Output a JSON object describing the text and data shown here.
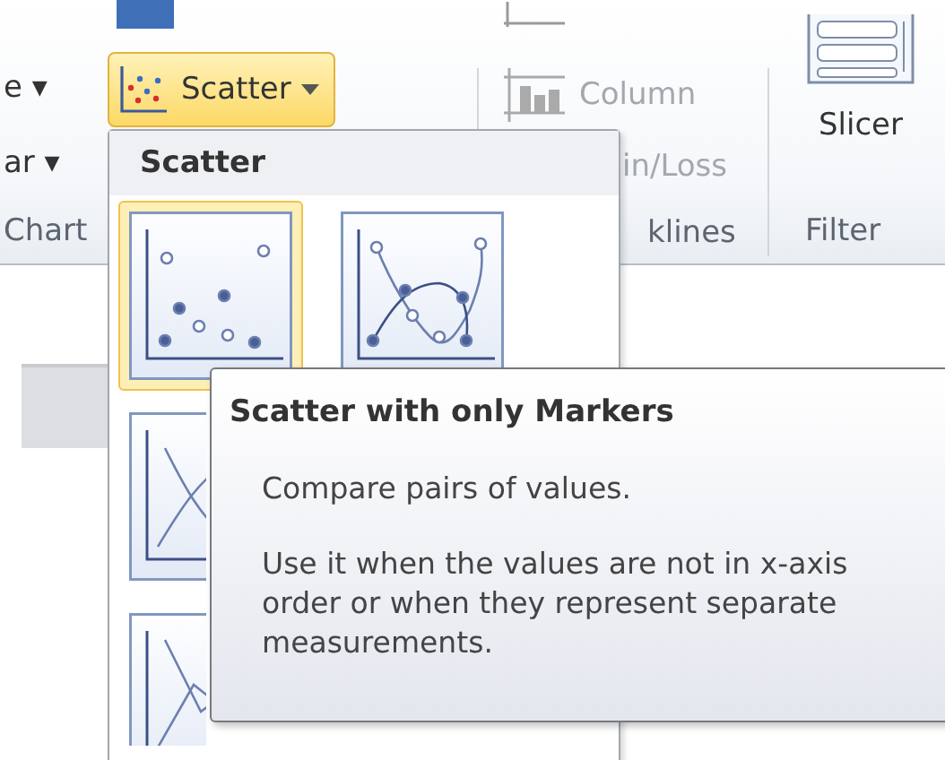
{
  "ribbon": {
    "chart_group": {
      "items": [
        {
          "label": "e ▾"
        },
        {
          "label": "ar ▾"
        }
      ],
      "group_label": "Chart"
    },
    "scatter_button": {
      "label": "Scatter",
      "open": true
    },
    "sparklines_group": {
      "items": [
        {
          "label": "Column"
        },
        {
          "label": "in/Loss"
        }
      ],
      "group_label": "klines"
    },
    "filter_group": {
      "button": "Slicer",
      "group_label": "Filter"
    }
  },
  "dropdown": {
    "header": "Scatter",
    "options": [
      {
        "kind": "markers",
        "selected": true
      },
      {
        "kind": "smooth-markers",
        "selected": false
      },
      {
        "kind": "smooth-lines",
        "selected": false
      },
      {
        "kind": "straight-lines",
        "selected": false
      }
    ]
  },
  "tooltip": {
    "title": "Scatter with only Markers",
    "paragraphs": [
      "Compare pairs of values.",
      "Use it when the values are not in x-axis order or when they represent separate measurements."
    ]
  }
}
